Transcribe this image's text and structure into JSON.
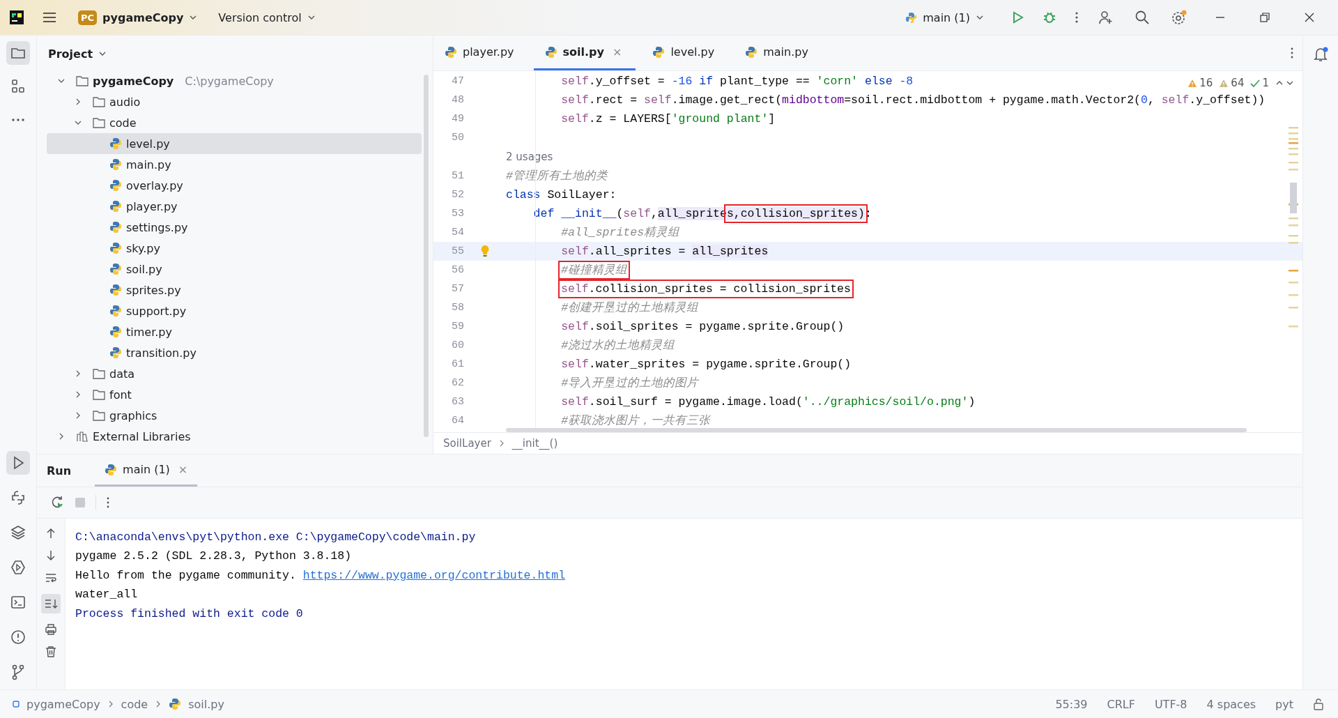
{
  "title_bar": {
    "logo": "PC",
    "project": "pygameCopy",
    "vcs": "Version control",
    "run_config": "main (1)"
  },
  "project_panel": {
    "title": "Project",
    "tree": [
      {
        "name": "pygameCopy",
        "path": "C:\\pygameCopy",
        "kind": "root",
        "expanded": true,
        "selected": false,
        "children": [
          {
            "name": "audio",
            "kind": "folder",
            "expanded": false,
            "selected": false
          },
          {
            "name": "code",
            "kind": "folder",
            "expanded": true,
            "selected": false,
            "children": [
              {
                "name": "level.py",
                "kind": "file",
                "selected": true
              },
              {
                "name": "main.py",
                "kind": "file",
                "selected": false
              },
              {
                "name": "overlay.py",
                "kind": "file",
                "selected": false
              },
              {
                "name": "player.py",
                "kind": "file",
                "selected": false
              },
              {
                "name": "settings.py",
                "kind": "file",
                "selected": false
              },
              {
                "name": "sky.py",
                "kind": "file",
                "selected": false
              },
              {
                "name": "soil.py",
                "kind": "file",
                "selected": false
              },
              {
                "name": "sprites.py",
                "kind": "file",
                "selected": false
              },
              {
                "name": "support.py",
                "kind": "file",
                "selected": false
              },
              {
                "name": "timer.py",
                "kind": "file",
                "selected": false
              },
              {
                "name": "transition.py",
                "kind": "file",
                "selected": false
              }
            ]
          },
          {
            "name": "data",
            "kind": "folder",
            "expanded": false,
            "selected": false
          },
          {
            "name": "font",
            "kind": "folder",
            "expanded": false,
            "selected": false
          },
          {
            "name": "graphics",
            "kind": "folder",
            "expanded": false,
            "selected": false
          }
        ]
      },
      {
        "name": "External Libraries",
        "kind": "library",
        "expanded": false,
        "selected": false
      }
    ]
  },
  "editor_tabs": [
    {
      "label": "player.py",
      "selected": false
    },
    {
      "label": "soil.py",
      "selected": true,
      "close": "×"
    },
    {
      "label": "level.py",
      "selected": false
    },
    {
      "label": "main.py",
      "selected": false
    }
  ],
  "inspections": {
    "warnings": "16",
    "weak_warnings": "64",
    "typos": "1"
  },
  "code": [
    {
      "number": "47",
      "segments": [
        {
          "kind": "self",
          "text": "        self"
        },
        {
          "kind": "plain",
          "text": ".y_offset = "
        },
        {
          "kind": "num",
          "text": "-16"
        },
        {
          "kind": "kw",
          "text": " if "
        },
        {
          "kind": "plain",
          "text": "plant_type == "
        },
        {
          "kind": "str",
          "text": "'corn'"
        },
        {
          "kind": "kw",
          "text": " else "
        },
        {
          "kind": "num",
          "text": "-8"
        }
      ]
    },
    {
      "number": "48",
      "segments": [
        {
          "kind": "self",
          "text": "        self"
        },
        {
          "kind": "plain",
          "text": ".rect = "
        },
        {
          "kind": "self",
          "text": "self"
        },
        {
          "kind": "plain",
          "text": ".image.get_rect("
        },
        {
          "kind": "param",
          "text": "midbottom"
        },
        {
          "kind": "plain",
          "text": "=soil.rect.midbottom + pygame.math.Vector2("
        },
        {
          "kind": "num",
          "text": "0"
        },
        {
          "kind": "plain",
          "text": ", "
        },
        {
          "kind": "self",
          "text": "self"
        },
        {
          "kind": "plain",
          "text": ".y_offset))"
        }
      ]
    },
    {
      "number": "49",
      "segments": [
        {
          "kind": "self",
          "text": "        self"
        },
        {
          "kind": "plain",
          "text": ".z = LAYERS["
        },
        {
          "kind": "str",
          "text": "'ground plant'"
        },
        {
          "kind": "plain",
          "text": "]"
        }
      ]
    },
    {
      "number": "50"
    },
    {
      "number": "51",
      "segments": [
        {
          "kind": "cmt",
          "text": "#管理所有土地的类"
        }
      ],
      "usages": "2 usages"
    },
    {
      "number": "52",
      "segments": [
        {
          "kind": "kw",
          "text": "class"
        },
        {
          "kind": "plain",
          "text": " SoilLayer:"
        }
      ]
    },
    {
      "number": "53",
      "segments": [
        {
          "kind": "kw",
          "text": "    def "
        },
        {
          "kind": "fn",
          "text": "__init__"
        },
        {
          "kind": "plain",
          "text": "("
        },
        {
          "kind": "self",
          "text": "self"
        },
        {
          "kind": "plain",
          "text": ","
        },
        {
          "kind": "usage",
          "text": "all_sprite"
        },
        {
          "kind": "usage",
          "text": "s,collision_sprites)",
          "boxed": true
        },
        {
          "kind": "plain",
          "text": ":"
        }
      ]
    },
    {
      "number": "54",
      "segments": [
        {
          "kind": "cmt",
          "text": "        #all_sprites精灵组"
        }
      ]
    },
    {
      "number": "55",
      "current": true,
      "bulb": true,
      "segments": [
        {
          "kind": "self",
          "text": "        self"
        },
        {
          "kind": "plain",
          "text": ".all_sprites = "
        },
        {
          "kind": "usage",
          "text": "all_sprites"
        }
      ]
    },
    {
      "number": "56",
      "segments": [
        {
          "kind": "cmt",
          "text": "#碰撞精灵组",
          "boxed": true
        }
      ],
      "indented": true
    },
    {
      "number": "57",
      "segments": [
        {
          "kind": "self",
          "text": "self",
          "boxed": true
        },
        {
          "kind": "plain",
          "text": ".collision_sprites = collision_sprites",
          "boxed": true
        }
      ],
      "indented": true
    },
    {
      "number": "58",
      "segments": [
        {
          "kind": "cmt",
          "text": "        #创建开垦过的土地精灵组"
        }
      ]
    },
    {
      "number": "59",
      "segments": [
        {
          "kind": "self",
          "text": "        self"
        },
        {
          "kind": "plain",
          "text": ".soil_sprites = pygame.sprite.Group()"
        }
      ]
    },
    {
      "number": "60",
      "segments": [
        {
          "kind": "cmt",
          "text": "        #浇过水的土地精灵组"
        }
      ]
    },
    {
      "number": "61",
      "segments": [
        {
          "kind": "self",
          "text": "        self"
        },
        {
          "kind": "plain",
          "text": ".water_sprites = pygame.sprite.Group()"
        }
      ]
    },
    {
      "number": "62",
      "segments": [
        {
          "kind": "cmt",
          "text": "        #导入开垦过的土地的图片"
        }
      ]
    },
    {
      "number": "63",
      "segments": [
        {
          "kind": "self",
          "text": "        self"
        },
        {
          "kind": "plain",
          "text": ".soil_surf = pygame.image.load("
        },
        {
          "kind": "str",
          "text": "'../graphics/soil/o.png'"
        },
        {
          "kind": "plain",
          "text": ")"
        }
      ]
    },
    {
      "number": "64",
      "segments": [
        {
          "kind": "cmt",
          "text": "        #获取浇水图片，一共有三张"
        }
      ]
    }
  ],
  "breadcrumb": [
    "SoilLayer",
    "__init__()"
  ],
  "run_panel": {
    "title": "Run",
    "tabs": [
      {
        "label": "main (1)",
        "selected": true,
        "close": "×"
      }
    ],
    "console": [
      [
        {
          "kind": "cmd",
          "text": "C:\\anaconda\\envs\\pyt\\python.exe C:\\pygameCopy\\code\\main.py"
        }
      ],
      [
        {
          "kind": "out",
          "text": "pygame 2.5.2 (SDL 2.28.3, Python 3.8.18)"
        }
      ],
      [
        {
          "kind": "out",
          "text": "Hello from the pygame community. "
        },
        {
          "kind": "link",
          "text": "https://www.pygame.org/contribute.html"
        }
      ],
      [
        {
          "kind": "out",
          "text": "water_all"
        }
      ],
      [
        {
          "kind": "status",
          "text": "Process finished with exit code 0"
        }
      ]
    ]
  },
  "status_bar": {
    "path": [
      "pygameCopy",
      "code",
      "soil.py"
    ],
    "position": "55:39",
    "line_sep": "CRLF",
    "encoding": "UTF-8",
    "indent": "4 spaces",
    "interpreter": "pyt"
  }
}
